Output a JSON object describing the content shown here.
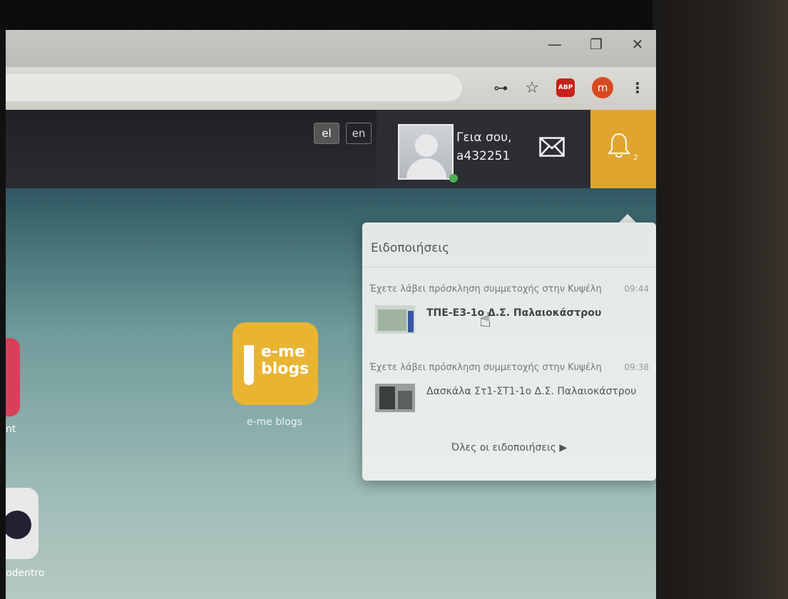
{
  "window": {
    "minimize": "—",
    "restore": "❐",
    "close": "✕"
  },
  "toolbar": {
    "key_icon": "key-icon",
    "star_icon": "star-icon",
    "abp_label": "ABP",
    "profile_initial": "m",
    "menu": "⋮"
  },
  "header": {
    "lang_el": "el",
    "lang_en": "en",
    "greeting_line1": "Γεια σου,",
    "greeting_line2": "a432251",
    "notification_count": "2"
  },
  "desktop": {
    "left_tile_label": "nt",
    "blogs_tile_text1": "e-me",
    "blogs_tile_text2": "blogs",
    "blogs_tile_label": "e-me blogs",
    "bottom_tile_label": "odentro"
  },
  "notifications": {
    "title": "Ειδοποιήσεις",
    "items": [
      {
        "message": "Έχετε λάβει πρόσκληση συμμετοχής στην Κυψέλη",
        "time": "09:44",
        "group": "ΤΠΕ-Ε3-1ο Δ.Σ. Παλαιοκάστρου"
      },
      {
        "message": "Έχετε λάβει πρόσκληση συμμετοχής στην Κυψέλη",
        "time": "09:38",
        "group": "Δασκάλα Στ1-ΣΤ1-1ο Δ.Σ. Παλαιοκάστρου"
      }
    ],
    "all_link": "Όλες οι ειδοποιήσεις ▶"
  },
  "colors": {
    "accent": "#e0a52e",
    "header_bg": "#24262b",
    "abp_red": "#c8201b",
    "profile_orange": "#d94a22"
  }
}
